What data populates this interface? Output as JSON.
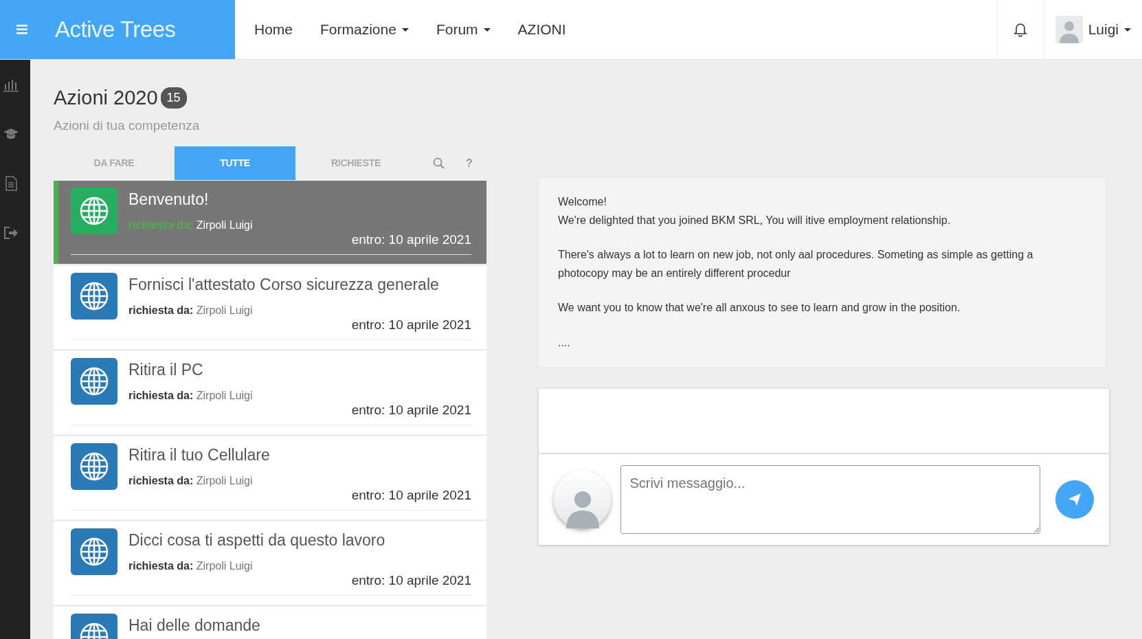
{
  "navbar": {
    "brand": "Active Trees",
    "links": [
      {
        "label": "Home",
        "dropdown": false
      },
      {
        "label": "Formazione",
        "dropdown": true
      },
      {
        "label": "Forum",
        "dropdown": true
      },
      {
        "label": "AZIONI",
        "dropdown": false
      }
    ],
    "user": {
      "name": "Luigi"
    }
  },
  "page": {
    "title": "Azioni 2020",
    "count": "15",
    "subtitle": "Azioni di tua competenza"
  },
  "tabs": [
    {
      "label": "DA FARE",
      "selected": false
    },
    {
      "label": "TUTTE",
      "selected": true
    },
    {
      "label": "RICHIESTE",
      "selected": false
    }
  ],
  "help_label": "?",
  "actions": [
    {
      "title": "Benvenuto!",
      "requester_label": "richiesta da:",
      "requester": "Zirpoli Luigi",
      "due": "entro: 10 aprile 2021",
      "selected": true
    },
    {
      "title": "Fornisci l'attestato Corso sicurezza generale",
      "requester_label": "richiesta da:",
      "requester": "Zirpoli Luigi",
      "due": "entro: 10 aprile 2021",
      "selected": false
    },
    {
      "title": "Ritira il PC",
      "requester_label": "richiesta da:",
      "requester": "Zirpoli Luigi",
      "due": "entro: 10 aprile 2021",
      "selected": false
    },
    {
      "title": "Ritira il tuo Cellulare",
      "requester_label": "richiesta da:",
      "requester": "Zirpoli Luigi",
      "due": "entro: 10 aprile 2021",
      "selected": false
    },
    {
      "title": "Dicci cosa ti aspetti da questo lavoro",
      "requester_label": "richiesta da:",
      "requester": "Zirpoli Luigi",
      "due": "entro: 10 aprile 2021",
      "selected": false
    },
    {
      "title": "Hai delle domande",
      "selected": false
    }
  ],
  "message": {
    "paragraphs": [
      [
        "Welcome!",
        "We're delighted that you joined BKM SRL, You will itive employment relationship."
      ],
      [
        "There's always a lot to learn on new job, not only aal procedures. Someting as simple as getting a photocopy may be an entirely different procedur"
      ],
      [
        "We want you to know that we're all anxous to see to learn and grow in the position."
      ],
      [
        "...."
      ]
    ]
  },
  "composer": {
    "placeholder": "Scrivi messaggio..."
  }
}
